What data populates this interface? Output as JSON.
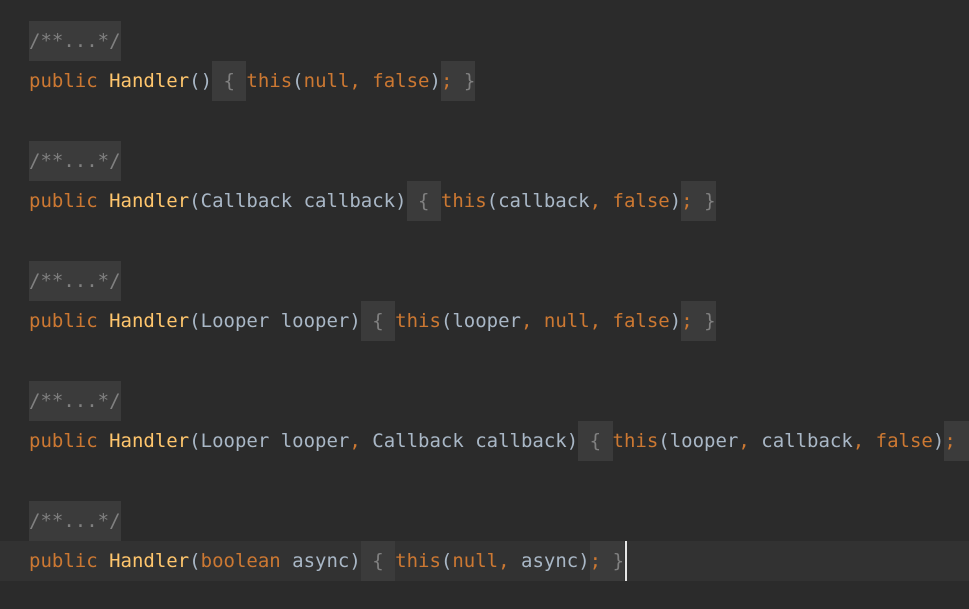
{
  "editor": {
    "folded_comment": "/**...*/",
    "constructors": [
      {
        "modifier": "public",
        "name": "Handler",
        "params_open": "(",
        "params": [],
        "params_close": ")",
        "brace_open": " { ",
        "body_call": "this",
        "args_open": "(",
        "args": [
          "null",
          "false"
        ],
        "args_close": ")",
        "semi": ";",
        "brace_close": " }"
      },
      {
        "modifier": "public",
        "name": "Handler",
        "params_open": "(",
        "params": [
          {
            "type": "Callback",
            "name": "callback",
            "type_is_keyword": false
          }
        ],
        "params_close": ")",
        "brace_open": " { ",
        "body_call": "this",
        "args_open": "(",
        "args": [
          "callback",
          "false"
        ],
        "args_close": ")",
        "semi": ";",
        "brace_close": " }"
      },
      {
        "modifier": "public",
        "name": "Handler",
        "params_open": "(",
        "params": [
          {
            "type": "Looper",
            "name": "looper",
            "type_is_keyword": false
          }
        ],
        "params_close": ")",
        "brace_open": " { ",
        "body_call": "this",
        "args_open": "(",
        "args": [
          "looper",
          "null",
          "false"
        ],
        "args_close": ")",
        "semi": ";",
        "brace_close": " }"
      },
      {
        "modifier": "public",
        "name": "Handler",
        "params_open": "(",
        "params": [
          {
            "type": "Looper",
            "name": "looper",
            "type_is_keyword": false
          },
          {
            "type": "Callback",
            "name": "callback",
            "type_is_keyword": false
          }
        ],
        "params_close": ")",
        "brace_open": " { ",
        "body_call": "this",
        "args_open": "(",
        "args": [
          "looper",
          "callback",
          "false"
        ],
        "args_close": ")",
        "semi": ";",
        "brace_close": " }"
      },
      {
        "modifier": "public",
        "name": "Handler",
        "params_open": "(",
        "params": [
          {
            "type": "boolean",
            "name": "async",
            "type_is_keyword": true
          }
        ],
        "params_close": ")",
        "brace_open": " { ",
        "body_call": "this",
        "args_open": "(",
        "args": [
          "null",
          "async"
        ],
        "args_close": ")",
        "semi": ";",
        "brace_close": " }"
      }
    ],
    "colors": {
      "background": "#2b2b2b",
      "keyword": "#cc7832",
      "method": "#ffc66d",
      "identifier": "#a9b7c6",
      "comment": "#808080",
      "fold_background": "#3b3b3b",
      "current_line": "#323232"
    }
  }
}
